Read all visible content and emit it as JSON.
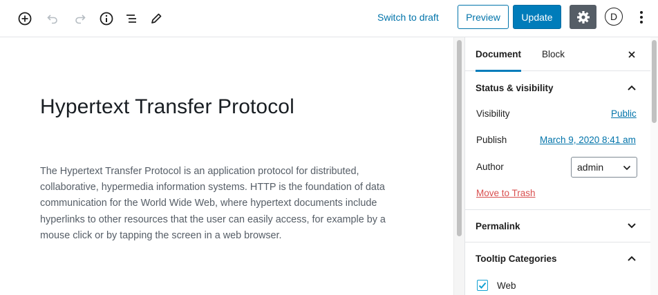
{
  "toolbar": {
    "icons": [
      "add-block-icon",
      "undo-icon",
      "redo-icon",
      "info-icon",
      "block-navigation-icon",
      "edit-icon",
      "gear-icon",
      "more-vertical-icon"
    ],
    "switch_to_draft": "Switch to draft",
    "preview": "Preview",
    "update": "Update",
    "avatar_letter": "D"
  },
  "editor": {
    "title": "Hypertext Transfer Protocol",
    "body": "The Hypertext Transfer Protocol is an application protocol for distributed, collaborative, hypermedia information systems. HTTP is the foundation of data communication for the World Wide Web, where hypertext documents include hyperlinks to other resources that the user can easily access, for example by a mouse click or by tapping the screen in a web browser."
  },
  "sidebar": {
    "tabs": [
      {
        "label": "Document",
        "active": true
      },
      {
        "label": "Block",
        "active": false
      }
    ],
    "status_panel": {
      "title": "Status & visibility",
      "expanded": true,
      "visibility_label": "Visibility",
      "visibility_value": "Public",
      "publish_label": "Publish",
      "publish_value": "March 9, 2020 8:41 am",
      "author_label": "Author",
      "author_value": "admin",
      "trash": "Move to Trash"
    },
    "permalink_panel": {
      "title": "Permalink",
      "expanded": false
    },
    "tooltip_panel": {
      "title": "Tooltip Categories",
      "expanded": true,
      "categories": [
        {
          "label": "Web",
          "checked": true
        }
      ]
    }
  },
  "colors": {
    "accent": "#007cba",
    "link": "#0073aa",
    "danger": "#d94f4f",
    "settings_active": "#555d66"
  }
}
